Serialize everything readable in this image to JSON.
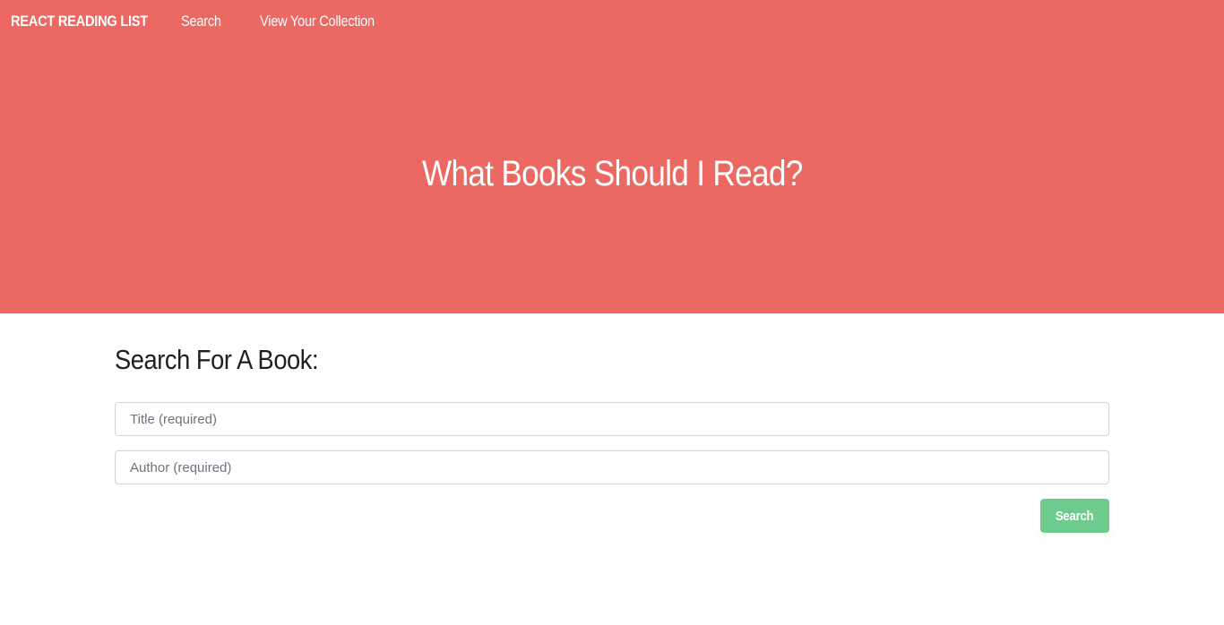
{
  "navbar": {
    "brand": "REACT READING LIST",
    "links": [
      {
        "label": "Search"
      },
      {
        "label": "View Your Collection"
      }
    ]
  },
  "hero": {
    "title": "What Books Should I Read?"
  },
  "search_form": {
    "heading": "Search For A Book:",
    "title_field": {
      "value": "",
      "placeholder": "Title (required)"
    },
    "author_field": {
      "value": "",
      "placeholder": "Author (required)"
    },
    "submit_label": "Search"
  },
  "colors": {
    "hero_background": "#ec6863",
    "button_background": "#6dcb8e",
    "heading_text": "#1f1f1f"
  }
}
